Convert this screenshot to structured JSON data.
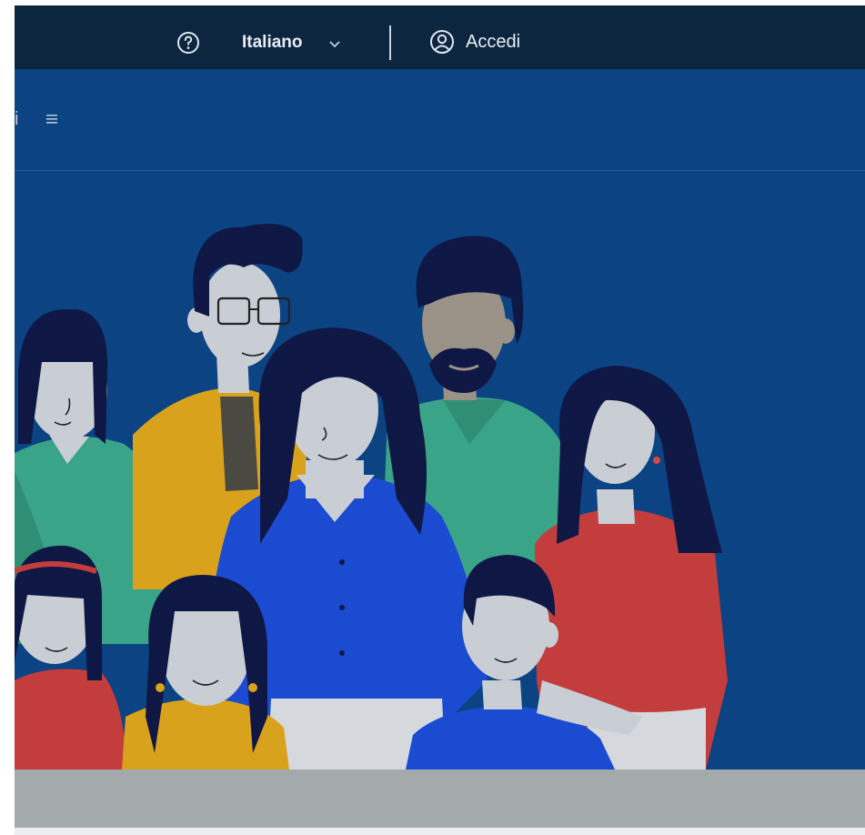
{
  "topbar": {
    "language": "Italiano",
    "login_label": "Accedi"
  },
  "navbar": {
    "truncated_item": "i"
  },
  "icons": {
    "help": "help-circle-icon",
    "chevron": "chevron-down-icon",
    "user": "user-circle-icon",
    "menu": "hamburger-menu-icon"
  },
  "colors": {
    "topbar_bg": "#0c2640",
    "hero_bg": "#0b4383",
    "footer_band": "#a4a9ac"
  }
}
